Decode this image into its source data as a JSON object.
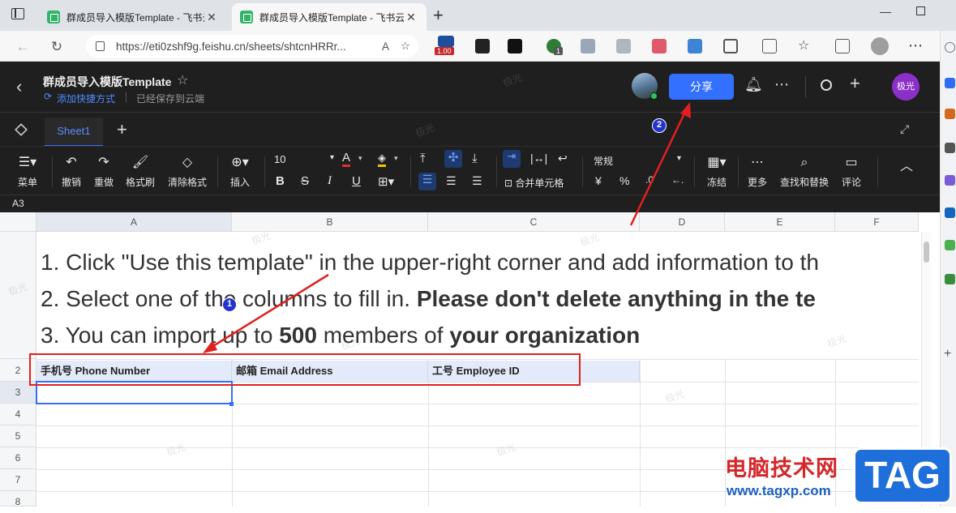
{
  "browser": {
    "tabs": [
      {
        "title": "群成员导入模版Template - 飞书云",
        "active": false
      },
      {
        "title": "群成员导入模版Template - 飞书云",
        "active": true
      }
    ],
    "url": "https://eti0zshf9g.feishu.cn/sheets/shtcnHRRr...",
    "ext_badge_a": "1.00",
    "ext_badge_b": "1"
  },
  "doc": {
    "title": "群成员导入模版Template",
    "shortcut_label": "添加快捷方式",
    "save_status": "已经保存到云端",
    "share_label": "分享",
    "avatar_text": "极光"
  },
  "sheet_tab": {
    "label": "Sheet1",
    "add": "+"
  },
  "toolbar": {
    "menu": "菜单",
    "undo": "撤销",
    "redo": "重做",
    "format_painter": "格式刷",
    "clear_format": "清除格式",
    "insert": "插入",
    "font_size": "10",
    "merge_cells": "合并单元格",
    "number_format": "常规",
    "freeze": "冻结",
    "more": "更多",
    "find_replace": "查找和替换",
    "comment": "评论"
  },
  "cell_ref": "A3",
  "columns": [
    "A",
    "B",
    "C",
    "D",
    "E",
    "F"
  ],
  "rows": [
    "2",
    "3",
    "4",
    "5",
    "6",
    "7",
    "8"
  ],
  "instructions": {
    "line1": "1. Click \"Use this template\" in the upper-right corner and add information to th",
    "line2_plain": "2. Select one of the columns to fill in. ",
    "line2_bold": "Please don't delete anything in the te",
    "line3_a": "3. You can import up to ",
    "line3_b": "500",
    "line3_c": " members of ",
    "line3_d": "your organization"
  },
  "headers": {
    "phone": "手机号 Phone Number",
    "email": "邮箱 Email Address",
    "employee": "工号 Employee ID"
  },
  "annotations": {
    "marker1": "1",
    "marker2": "2"
  },
  "watermark_text": "极光",
  "site_logo": {
    "cn": "电脑技术网",
    "url": "www.tagxp.com",
    "tag": "TAG"
  },
  "colors": {
    "accent_blue": "#3370ff",
    "annotation_red": "#e02020",
    "header_fill": "#e3eaf9"
  }
}
